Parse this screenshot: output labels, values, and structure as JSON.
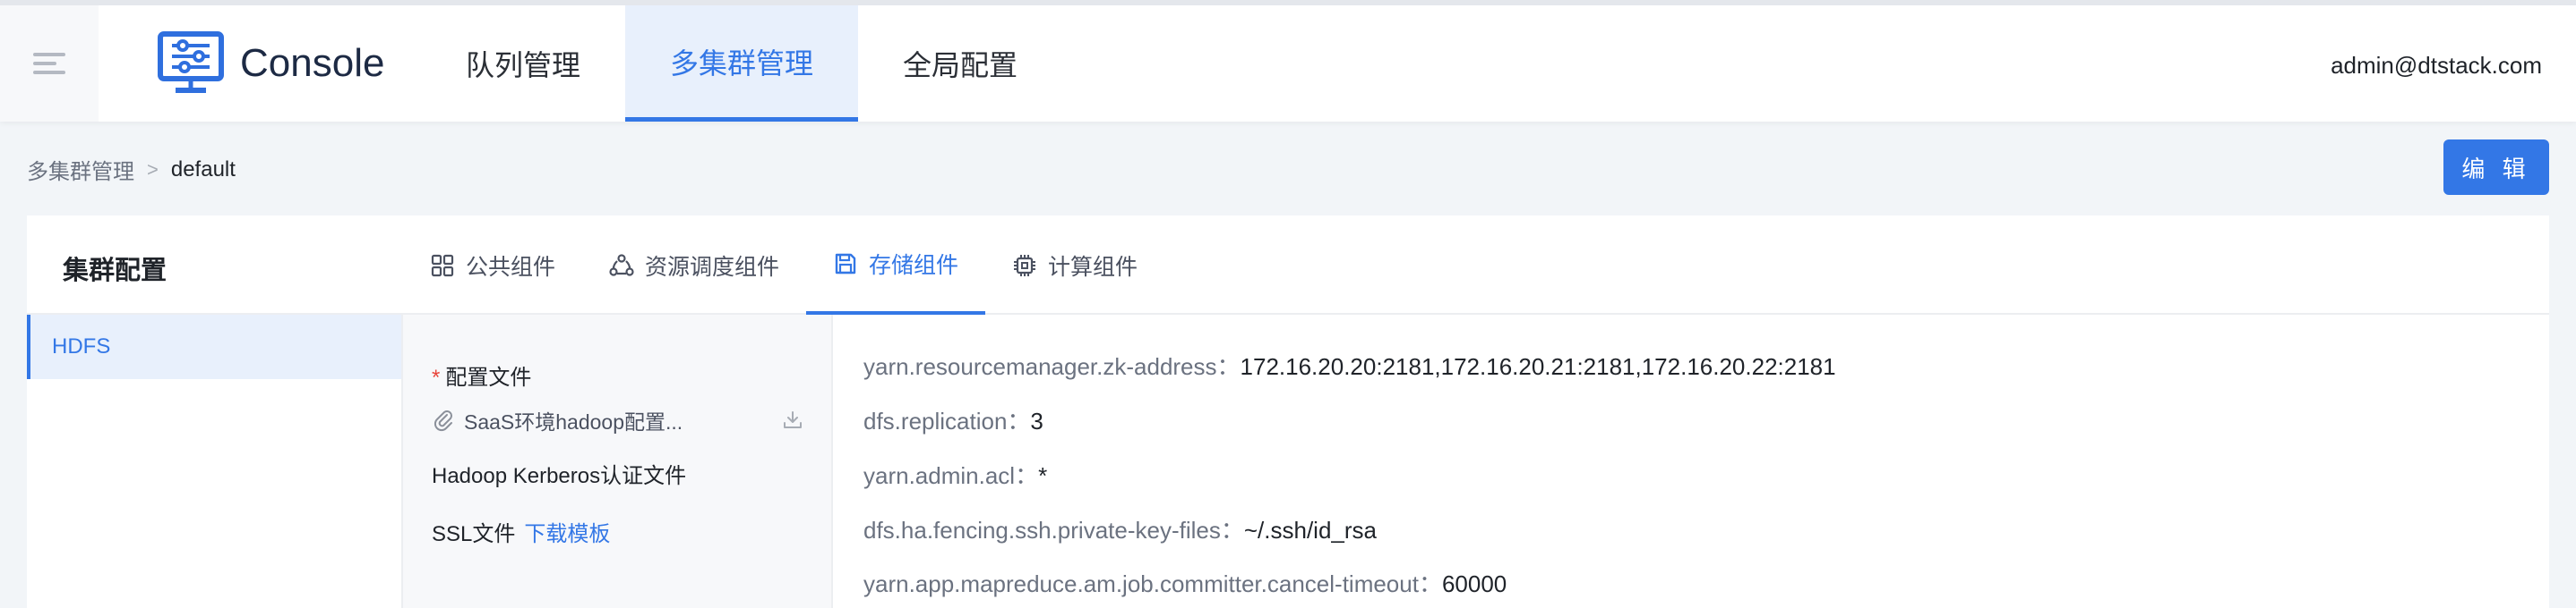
{
  "header": {
    "app_name": "Console",
    "nav": [
      {
        "label": "队列管理"
      },
      {
        "label": "多集群管理"
      },
      {
        "label": "全局配置"
      }
    ],
    "user": "admin@dtstack.com"
  },
  "breadcrumb": {
    "parent": "多集群管理",
    "separator": ">",
    "current": "default"
  },
  "toolbar": {
    "edit_label": "编 辑"
  },
  "card": {
    "title": "集群配置",
    "tabs": [
      {
        "label": "公共组件",
        "icon": "grid-icon"
      },
      {
        "label": "资源调度组件",
        "icon": "nodes-icon"
      },
      {
        "label": "存储组件",
        "icon": "save-icon"
      },
      {
        "label": "计算组件",
        "icon": "chip-icon"
      }
    ],
    "components": [
      "HDFS"
    ]
  },
  "files": {
    "config_required_mark": "*",
    "config_label": "配置文件",
    "config_file_name": "SaaS环境hadoop配置...",
    "kerberos_label": "Hadoop Kerberos认证文件",
    "ssl_label": "SSL文件",
    "ssl_link": "下载模板"
  },
  "params": [
    {
      "key": "yarn.resourcemanager.zk-address：",
      "value": "172.16.20.20:2181,172.16.20.21:2181,172.16.20.22:2181"
    },
    {
      "key": "dfs.replication：",
      "value": "3"
    },
    {
      "key": "yarn.admin.acl：",
      "value": "*"
    },
    {
      "key": "dfs.ha.fencing.ssh.private-key-files：",
      "value": "~/.ssh/id_rsa"
    },
    {
      "key": "yarn.app.mapreduce.am.job.committer.cancel-timeout：",
      "value": "60000"
    }
  ],
  "colors": {
    "accent": "#3377e6",
    "accent_bg": "#e8f0fc",
    "required": "#e8443a",
    "page_bg": "#f2f5f8"
  }
}
